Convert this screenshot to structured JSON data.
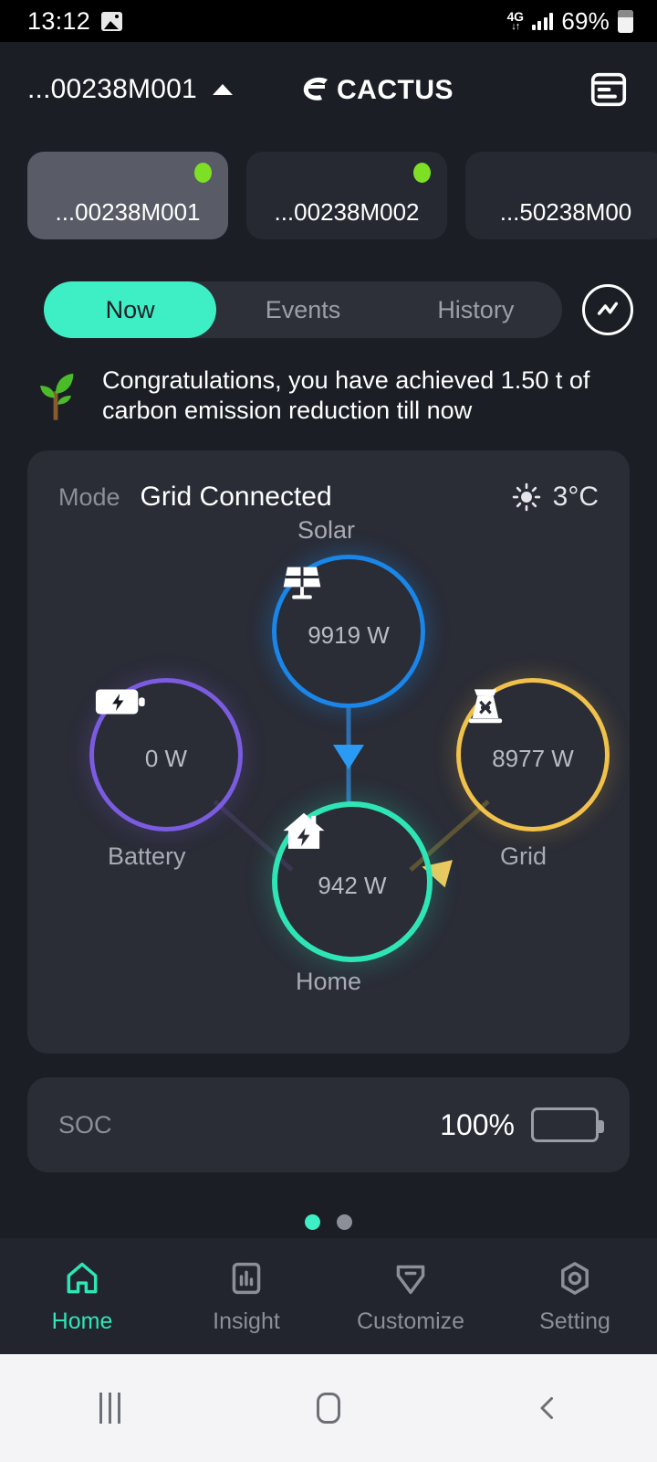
{
  "statusbar": {
    "time": "13:12",
    "photo_icon": "photo-icon",
    "network": "4G",
    "network_arrows": "↓↑",
    "battery_percent": "69%"
  },
  "header": {
    "device_selector": "...00238M001",
    "caret_icon": "caret-up-icon",
    "brand": "eCACTUS",
    "report_icon": "report-icon"
  },
  "devices": [
    {
      "label": "...00238M001",
      "online": true,
      "selected": true
    },
    {
      "label": "...00238M002",
      "online": true,
      "selected": false
    },
    {
      "label": "...50238M00",
      "online": false,
      "selected": false
    }
  ],
  "tabs": [
    {
      "label": "Now",
      "active": true
    },
    {
      "label": "Events",
      "active": false
    },
    {
      "label": "History",
      "active": false
    }
  ],
  "chart_button_icon": "chart-line-icon",
  "carbon": {
    "icon": "plant-icon",
    "message": "Congratulations, you have achieved 1.50 t of carbon emission reduction till now"
  },
  "flow": {
    "mode_label": "Mode",
    "mode_value": "Grid Connected",
    "weather_icon": "sun-icon",
    "temperature": "3°C",
    "nodes": {
      "solar": {
        "label": "Solar",
        "value": "9919 W",
        "icon": "solar-panel-icon",
        "color": "#1a86e8"
      },
      "battery": {
        "label": "Battery",
        "value": "0 W",
        "icon": "battery-bolt-icon",
        "color": "#7b5ce0"
      },
      "grid": {
        "label": "Grid",
        "value": "8977 W",
        "icon": "pylon-icon",
        "color": "#f0c14b"
      },
      "home": {
        "label": "Home",
        "value": "942 W",
        "icon": "house-bolt-icon",
        "color": "#2ee6b5"
      }
    }
  },
  "soc": {
    "label": "SOC",
    "value": "100%",
    "battery_icon": "battery-full-icon",
    "battery_color": "#23c653"
  },
  "pager": {
    "total": 2,
    "active_index": 0
  },
  "bottom_nav": [
    {
      "label": "Home",
      "icon": "home-icon",
      "active": true
    },
    {
      "label": "Insight",
      "icon": "bar-chart-icon",
      "active": false
    },
    {
      "label": "Customize",
      "icon": "shield-minus-icon",
      "active": false
    },
    {
      "label": "Setting",
      "icon": "gear-hex-icon",
      "active": false
    }
  ],
  "system_nav": {
    "recents_icon": "recents-icon",
    "home_icon": "home-square-icon",
    "back_icon": "back-chevron-icon"
  }
}
